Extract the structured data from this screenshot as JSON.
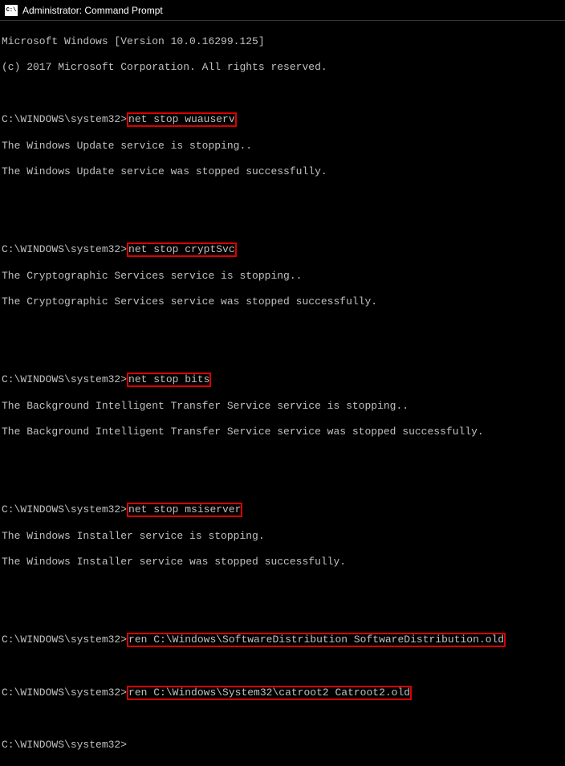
{
  "titlebar": {
    "title": "Administrator: Command Prompt"
  },
  "terminal": {
    "header1": "Microsoft Windows [Version 10.0.16299.125]",
    "header2": "(c) 2017 Microsoft Corporation. All rights reserved.",
    "prompt": "C:\\WINDOWS\\system32>",
    "cmd1": "net stop wuauserv",
    "out1a": "The Windows Update service is stopping..",
    "out1b": "The Windows Update service was stopped successfully.",
    "cmd2": "net stop cryptSvc",
    "out2a": "The Cryptographic Services service is stopping..",
    "out2b": "The Cryptographic Services service was stopped successfully.",
    "cmd3": "net stop bits",
    "out3a": "The Background Intelligent Transfer Service service is stopping..",
    "out3b": "The Background Intelligent Transfer Service service was stopped successfully.",
    "cmd4": "net stop msiserver",
    "out4a": "The Windows Installer service is stopping.",
    "out4b": "The Windows Installer service was stopped successfully.",
    "cmd5": "ren C:\\Windows\\SoftwareDistribution SoftwareDistribution.old",
    "cmd6": "ren C:\\Windows\\System32\\catroot2 Catroot2.old"
  }
}
